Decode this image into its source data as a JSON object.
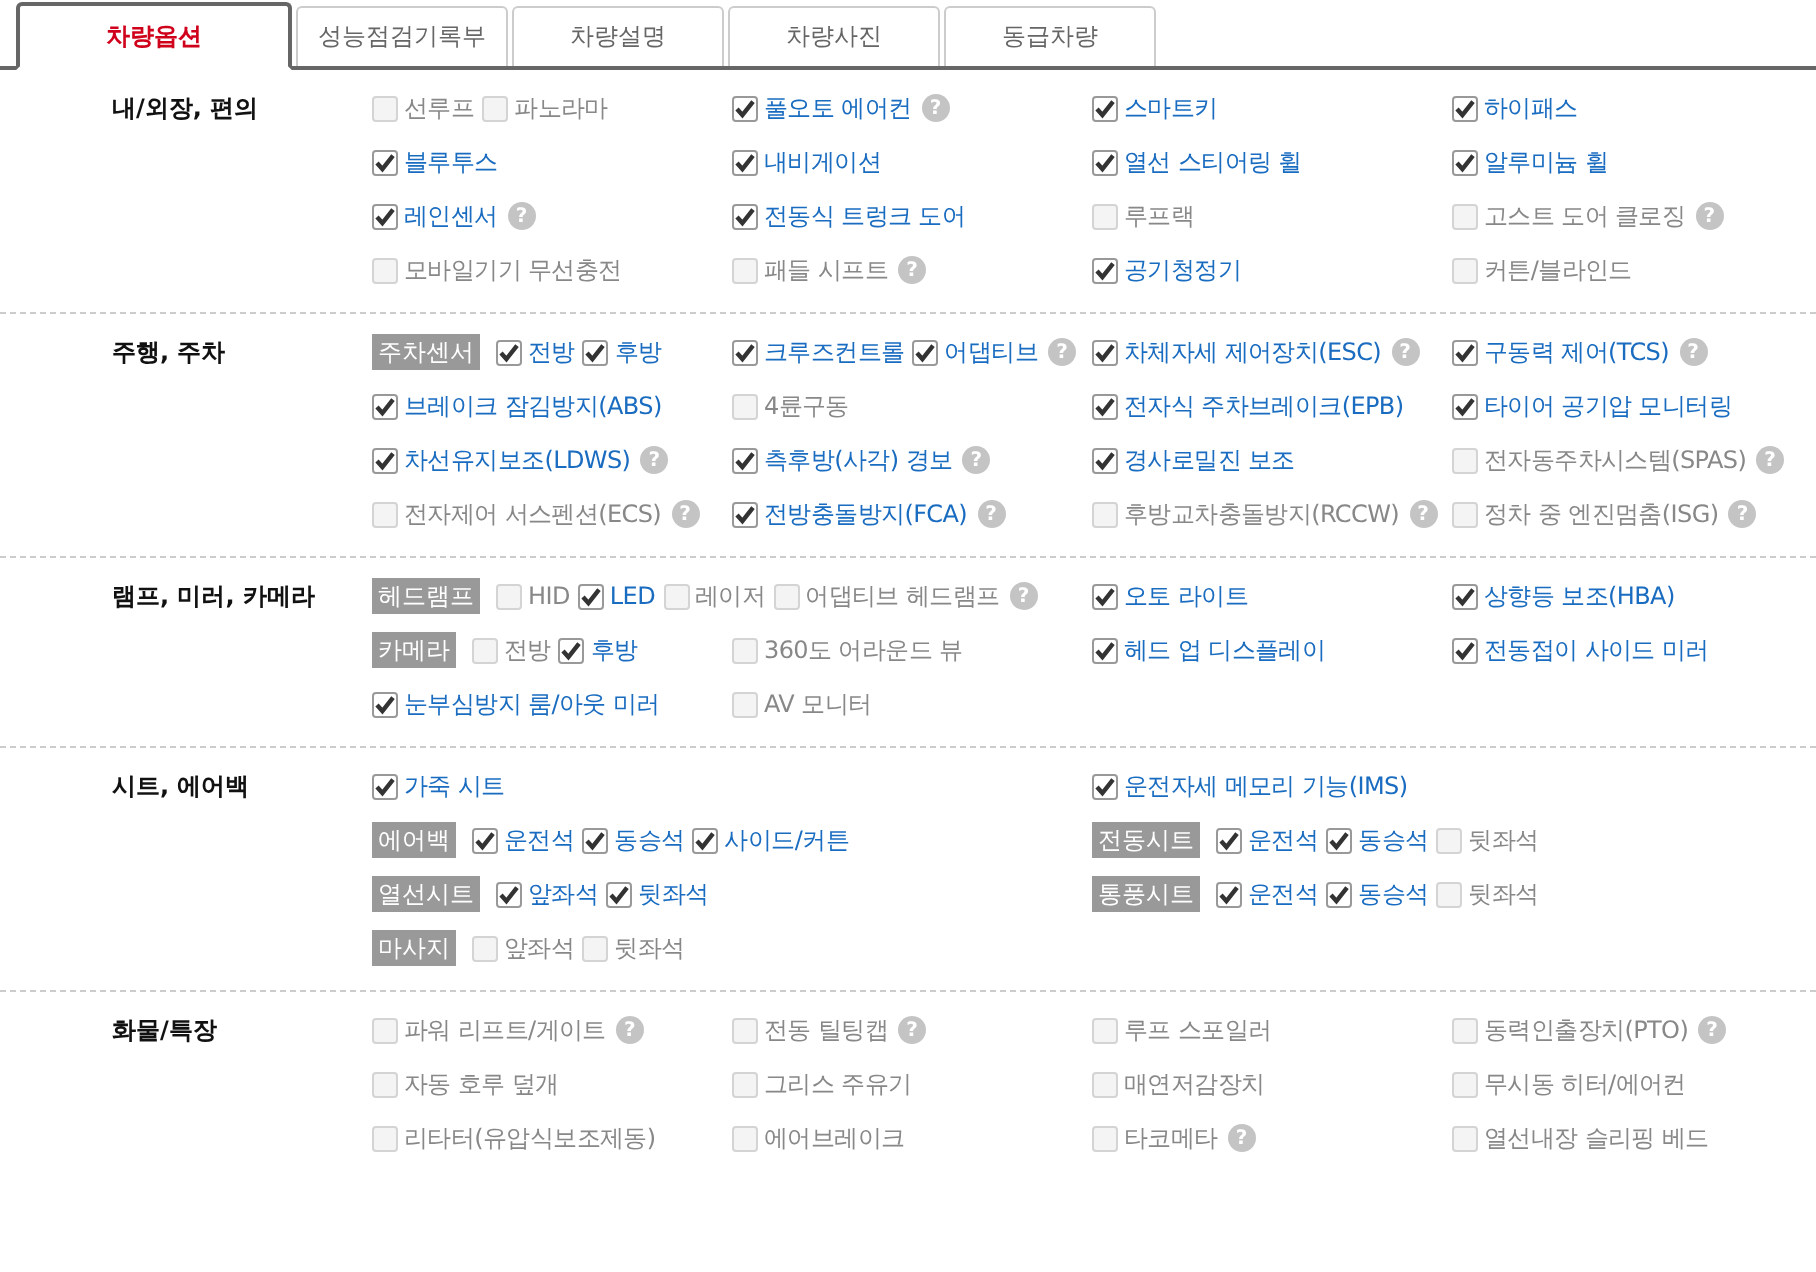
{
  "tabs": [
    {
      "label": "차량옵션",
      "selected": true
    },
    {
      "label": "성능점검기록부",
      "selected": false
    },
    {
      "label": "차량설명",
      "selected": false
    },
    {
      "label": "차량사진",
      "selected": false
    },
    {
      "label": "동급차량",
      "selected": false
    }
  ],
  "sections": [
    {
      "title": "내/외장, 편의",
      "rows": [
        [
          {
            "items": [
              {
                "kind": "option",
                "label": "선루프",
                "checked": false
              },
              {
                "kind": "option",
                "label": "파노라마",
                "checked": false
              }
            ]
          },
          {
            "items": [
              {
                "kind": "option",
                "label": "풀오토 에어컨",
                "checked": true,
                "help": "?"
              }
            ]
          },
          {
            "items": [
              {
                "kind": "option",
                "label": "스마트키",
                "checked": true
              }
            ]
          },
          {
            "items": [
              {
                "kind": "option",
                "label": "하이패스",
                "checked": true
              }
            ]
          }
        ],
        [
          {
            "items": [
              {
                "kind": "option",
                "label": "블루투스",
                "checked": true
              }
            ]
          },
          {
            "items": [
              {
                "kind": "option",
                "label": "내비게이션",
                "checked": true
              }
            ]
          },
          {
            "items": [
              {
                "kind": "option",
                "label": "열선 스티어링 휠",
                "checked": true
              }
            ]
          },
          {
            "items": [
              {
                "kind": "option",
                "label": "알루미늄 휠",
                "checked": true
              }
            ]
          }
        ],
        [
          {
            "items": [
              {
                "kind": "option",
                "label": "레인센서",
                "checked": true,
                "help": "?"
              }
            ]
          },
          {
            "items": [
              {
                "kind": "option",
                "label": "전동식 트렁크 도어",
                "checked": true
              }
            ]
          },
          {
            "items": [
              {
                "kind": "option",
                "label": "루프랙",
                "checked": false
              }
            ]
          },
          {
            "items": [
              {
                "kind": "option",
                "label": "고스트 도어 클로징",
                "checked": false,
                "help": "?"
              }
            ]
          }
        ],
        [
          {
            "items": [
              {
                "kind": "option",
                "label": "모바일기기 무선충전",
                "checked": false
              }
            ]
          },
          {
            "items": [
              {
                "kind": "option",
                "label": "패들 시프트",
                "checked": false,
                "help": "?"
              }
            ]
          },
          {
            "items": [
              {
                "kind": "option",
                "label": "공기청정기",
                "checked": true
              }
            ]
          },
          {
            "items": [
              {
                "kind": "option",
                "label": "커튼/블라인드",
                "checked": false
              }
            ]
          }
        ]
      ]
    },
    {
      "title": "주행, 주차",
      "rows": [
        [
          {
            "items": [
              {
                "kind": "tag",
                "text": "주차센서"
              },
              {
                "kind": "option",
                "label": "전방",
                "checked": true
              },
              {
                "kind": "option",
                "label": "후방",
                "checked": true
              }
            ]
          },
          {
            "items": [
              {
                "kind": "option",
                "label": "크루즈컨트롤",
                "checked": true
              },
              {
                "kind": "option",
                "label": "어댑티브",
                "checked": true,
                "help": "?"
              }
            ]
          },
          {
            "items": [
              {
                "kind": "option",
                "label": "차체자세 제어장치(ESC)",
                "checked": true,
                "help": "?"
              }
            ]
          },
          {
            "items": [
              {
                "kind": "option",
                "label": "구동력 제어(TCS)",
                "checked": true,
                "help": "?"
              }
            ]
          }
        ],
        [
          {
            "items": [
              {
                "kind": "option",
                "label": "브레이크 잠김방지(ABS)",
                "checked": true
              }
            ]
          },
          {
            "items": [
              {
                "kind": "option",
                "label": "4륜구동",
                "checked": false
              }
            ]
          },
          {
            "items": [
              {
                "kind": "option",
                "label": "전자식 주차브레이크(EPB)",
                "checked": true
              }
            ]
          },
          {
            "items": [
              {
                "kind": "option",
                "label": "타이어 공기압 모니터링",
                "checked": true
              }
            ]
          }
        ],
        [
          {
            "items": [
              {
                "kind": "option",
                "label": "차선유지보조(LDWS)",
                "checked": true,
                "help": "?"
              }
            ]
          },
          {
            "items": [
              {
                "kind": "option",
                "label": "측후방(사각) 경보",
                "checked": true,
                "help": "?"
              }
            ]
          },
          {
            "items": [
              {
                "kind": "option",
                "label": "경사로밀진 보조",
                "checked": true
              }
            ]
          },
          {
            "items": [
              {
                "kind": "option",
                "label": "전자동주차시스템(SPAS)",
                "checked": false,
                "help": "?"
              }
            ]
          }
        ],
        [
          {
            "items": [
              {
                "kind": "option",
                "label": "전자제어 서스펜션(ECS)",
                "checked": false,
                "help": "?"
              }
            ]
          },
          {
            "items": [
              {
                "kind": "option",
                "label": "전방충돌방지(FCA)",
                "checked": true,
                "help": "?"
              }
            ]
          },
          {
            "items": [
              {
                "kind": "option",
                "label": "후방교차충돌방지(RCCW)",
                "checked": false,
                "help": "?"
              }
            ]
          },
          {
            "items": [
              {
                "kind": "option",
                "label": "정차 중 엔진멈춤(ISG)",
                "checked": false,
                "help": "?"
              }
            ]
          }
        ]
      ]
    },
    {
      "title": "램프, 미러, 카메라",
      "rows": [
        [
          {
            "items": [
              {
                "kind": "tag",
                "text": "헤드램프"
              },
              {
                "kind": "option",
                "label": "HID",
                "checked": false
              },
              {
                "kind": "option",
                "label": "LED",
                "checked": true
              },
              {
                "kind": "option",
                "label": "레이저",
                "checked": false
              },
              {
                "kind": "option",
                "label": "어댑티브 헤드램프",
                "checked": false,
                "help": "?"
              }
            ]
          },
          "",
          {
            "items": [
              {
                "kind": "option",
                "label": "오토 라이트",
                "checked": true
              }
            ]
          },
          {
            "items": [
              {
                "kind": "option",
                "label": "상향등 보조(HBA)",
                "checked": true
              }
            ]
          }
        ],
        [
          {
            "items": [
              {
                "kind": "tag",
                "text": "카메라"
              },
              {
                "kind": "option",
                "label": "전방",
                "checked": false
              },
              {
                "kind": "option",
                "label": "후방",
                "checked": true
              }
            ]
          },
          {
            "items": [
              {
                "kind": "option",
                "label": "360도 어라운드 뷰",
                "checked": false
              }
            ]
          },
          {
            "items": [
              {
                "kind": "option",
                "label": "헤드 업 디스플레이",
                "checked": true
              }
            ]
          },
          {
            "items": [
              {
                "kind": "option",
                "label": "전동접이 사이드 미러",
                "checked": true
              }
            ]
          }
        ],
        [
          {
            "items": [
              {
                "kind": "option",
                "label": "눈부심방지 룸/아웃 미러",
                "checked": true
              }
            ]
          },
          {
            "items": [
              {
                "kind": "option",
                "label": "AV 모니터",
                "checked": false
              }
            ]
          }
        ]
      ]
    },
    {
      "title": "시트, 에어백",
      "rows": [
        [
          {
            "items": [
              {
                "kind": "option",
                "label": "가죽 시트",
                "checked": true
              }
            ]
          },
          "",
          {
            "items": [
              {
                "kind": "option",
                "label": "운전자세 메모리 기능(IMS)",
                "checked": true
              }
            ]
          }
        ],
        [
          {
            "items": [
              {
                "kind": "tag",
                "text": "에어백"
              },
              {
                "kind": "option",
                "label": "운전석",
                "checked": true
              },
              {
                "kind": "option",
                "label": "동승석",
                "checked": true
              },
              {
                "kind": "option",
                "label": "사이드/커튼",
                "checked": true
              }
            ]
          },
          "",
          {
            "items": [
              {
                "kind": "tag",
                "text": "전동시트"
              },
              {
                "kind": "option",
                "label": "운전석",
                "checked": true
              },
              {
                "kind": "option",
                "label": "동승석",
                "checked": true
              },
              {
                "kind": "option",
                "label": "뒷좌석",
                "checked": false
              }
            ]
          }
        ],
        [
          {
            "items": [
              {
                "kind": "tag",
                "text": "열선시트"
              },
              {
                "kind": "option",
                "label": "앞좌석",
                "checked": true
              },
              {
                "kind": "option",
                "label": "뒷좌석",
                "checked": true
              }
            ]
          },
          "",
          {
            "items": [
              {
                "kind": "tag",
                "text": "통풍시트"
              },
              {
                "kind": "option",
                "label": "운전석",
                "checked": true
              },
              {
                "kind": "option",
                "label": "동승석",
                "checked": true
              },
              {
                "kind": "option",
                "label": "뒷좌석",
                "checked": false
              }
            ]
          }
        ],
        [
          {
            "items": [
              {
                "kind": "tag",
                "text": "마사지"
              },
              {
                "kind": "option",
                "label": "앞좌석",
                "checked": false
              },
              {
                "kind": "option",
                "label": "뒷좌석",
                "checked": false
              }
            ]
          }
        ]
      ]
    },
    {
      "title": "화물/특장",
      "rows": [
        [
          {
            "items": [
              {
                "kind": "option",
                "label": "파워 리프트/게이트",
                "checked": false,
                "help": "?"
              }
            ]
          },
          {
            "items": [
              {
                "kind": "option",
                "label": "전동 틸팅캡",
                "checked": false,
                "help": "?"
              }
            ]
          },
          {
            "items": [
              {
                "kind": "option",
                "label": "루프 스포일러",
                "checked": false
              }
            ]
          },
          {
            "items": [
              {
                "kind": "option",
                "label": "동력인출장치(PTO)",
                "checked": false,
                "help": "?"
              }
            ]
          }
        ],
        [
          {
            "items": [
              {
                "kind": "option",
                "label": "자동 호루 덮개",
                "checked": false
              }
            ]
          },
          {
            "items": [
              {
                "kind": "option",
                "label": "그리스 주유기",
                "checked": false
              }
            ]
          },
          {
            "items": [
              {
                "kind": "option",
                "label": "매연저감장치",
                "checked": false
              }
            ]
          },
          {
            "items": [
              {
                "kind": "option",
                "label": "무시동 히터/에어컨",
                "checked": false
              }
            ]
          }
        ],
        [
          {
            "items": [
              {
                "kind": "option",
                "label": "리타터(유압식보조제동)",
                "checked": false
              }
            ]
          },
          {
            "items": [
              {
                "kind": "option",
                "label": "에어브레이크",
                "checked": false
              }
            ]
          },
          {
            "items": [
              {
                "kind": "option",
                "label": "타코메타",
                "checked": false,
                "help": "?"
              }
            ]
          },
          {
            "items": [
              {
                "kind": "option",
                "label": "열선내장 슬리핑 베드",
                "checked": false
              }
            ]
          }
        ]
      ]
    }
  ]
}
